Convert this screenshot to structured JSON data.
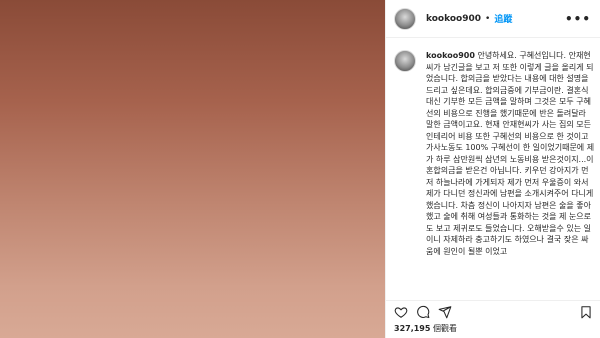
{
  "post": {
    "username": "kookoo900",
    "follow_label": "追蹤",
    "dot": "•",
    "more": "•••"
  },
  "caption": {
    "username": "kookoo900",
    "text": "안녕하세요. 구혜선입니다. 안재현씨가 남긴글을 보고 저 또한 이렇게 글을 올리게 되었습니다. 합의금을 받았다는 내용에 대한 설명을 드리고 싶은데요. 합의금중에 기부금이란. 결혼식대신 기부한 모든 금액을 말하며 그것은 모두 구혜선의 비용으로 진행을 했기때문에 반은 돌려달라 말한 금액이고요. 현재 안재현씨가 사는 집의 모든 인테리어 비용 또한 구혜선의 비용으로 한 것이고 가사노동도 100% 구혜선이 한 일이었기때문에 제가 하루 삼만원씩 삼년의 노동비용 받은것이지...이혼합의금을 받은건 아닙니다. 키우던 강아지가 먼저 하늘나라에 가게되자 제가 먼저 우울증이 와서 제가 다니던 정신과에 남편을 소개시켜주어 다니게했습니다. 차츰 정신이 나아지자 남편은 술을 좋아했고 술에 취해 여성들과 통화하는 것을 제 눈으로도 보고 제귀로도 들었습니다. 오해받을수 있는 일이니 자제하라 충고하기도 하였으나 결국 잦은 싸움에 원인이 될뿐 이었고"
  },
  "stats": {
    "views_count": "327,195",
    "views_label": "個觀看"
  },
  "icons": {
    "like": "heart-icon",
    "comment": "comment-icon",
    "share": "share-icon",
    "save": "bookmark-icon"
  }
}
